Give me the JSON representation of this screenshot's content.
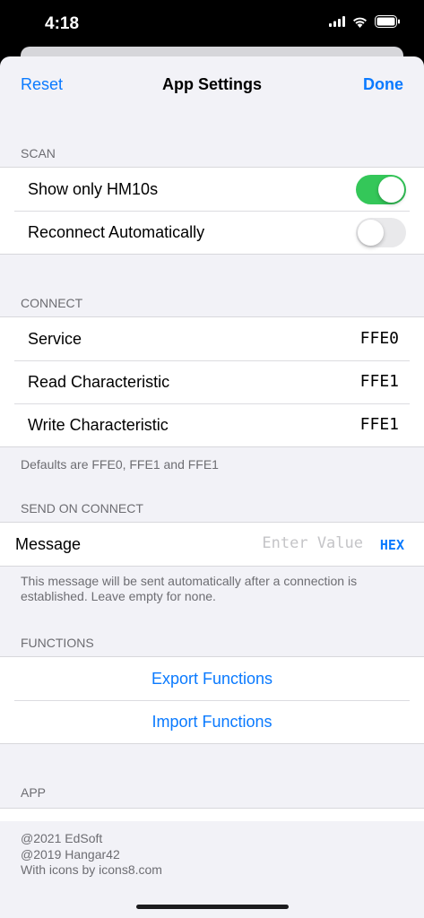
{
  "status_bar": {
    "time": "4:18",
    "icons": [
      "signal-icon",
      "wifi-icon",
      "battery-icon"
    ]
  },
  "nav": {
    "reset": "Reset",
    "title": "App Settings",
    "done": "Done"
  },
  "scan": {
    "header": "SCAN",
    "rows": [
      {
        "label": "Show only HM10s",
        "on": true
      },
      {
        "label": "Reconnect Automatically",
        "on": false
      }
    ]
  },
  "connect": {
    "header": "CONNECT",
    "rows": [
      {
        "label": "Service",
        "value": "FFE0"
      },
      {
        "label": "Read Characteristic",
        "value": "FFE1"
      },
      {
        "label": "Write Characteristic",
        "value": "FFE1"
      }
    ],
    "footer": "Defaults are FFE0, FFE1 and FFE1"
  },
  "send_on_connect": {
    "header": "SEND ON CONNECT",
    "label": "Message",
    "value": "",
    "placeholder": "Enter Value",
    "format": "HEX",
    "footer": "This message will be sent automatically after a connection is established. Leave empty for none."
  },
  "functions": {
    "header": "FUNCTIONS",
    "export": "Export Functions",
    "import": "Import Functions"
  },
  "app": {
    "header": "APP",
    "credits": [
      "@2021 EdSoft",
      "@2019 Hangar42",
      "With icons by icons8.com"
    ]
  },
  "colors": {
    "accent": "#0A7AFF",
    "toggle_on": "#34C759",
    "background": "#F2F2F7"
  }
}
